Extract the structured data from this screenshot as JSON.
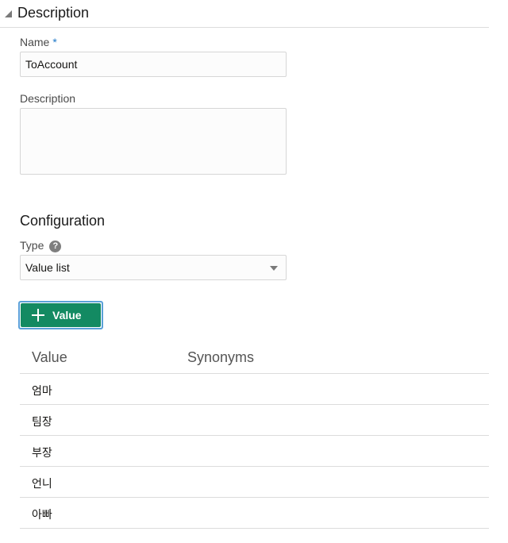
{
  "section": {
    "title": "Description"
  },
  "name_field": {
    "label": "Name",
    "required_mark": "*",
    "value": "ToAccount"
  },
  "description_field": {
    "label": "Description",
    "value": ""
  },
  "configuration": {
    "title": "Configuration",
    "type_label": "Type",
    "help_glyph": "?",
    "type_value": "Value list"
  },
  "add_button": {
    "label": "Value",
    "icon": "plus-icon",
    "color": "#138a62"
  },
  "table": {
    "columns": [
      "Value",
      "Synonyms"
    ],
    "rows": [
      {
        "value": "엄마",
        "synonyms": ""
      },
      {
        "value": "팀장",
        "synonyms": ""
      },
      {
        "value": "부장",
        "synonyms": ""
      },
      {
        "value": "언니",
        "synonyms": ""
      },
      {
        "value": "아빠",
        "synonyms": ""
      }
    ]
  }
}
